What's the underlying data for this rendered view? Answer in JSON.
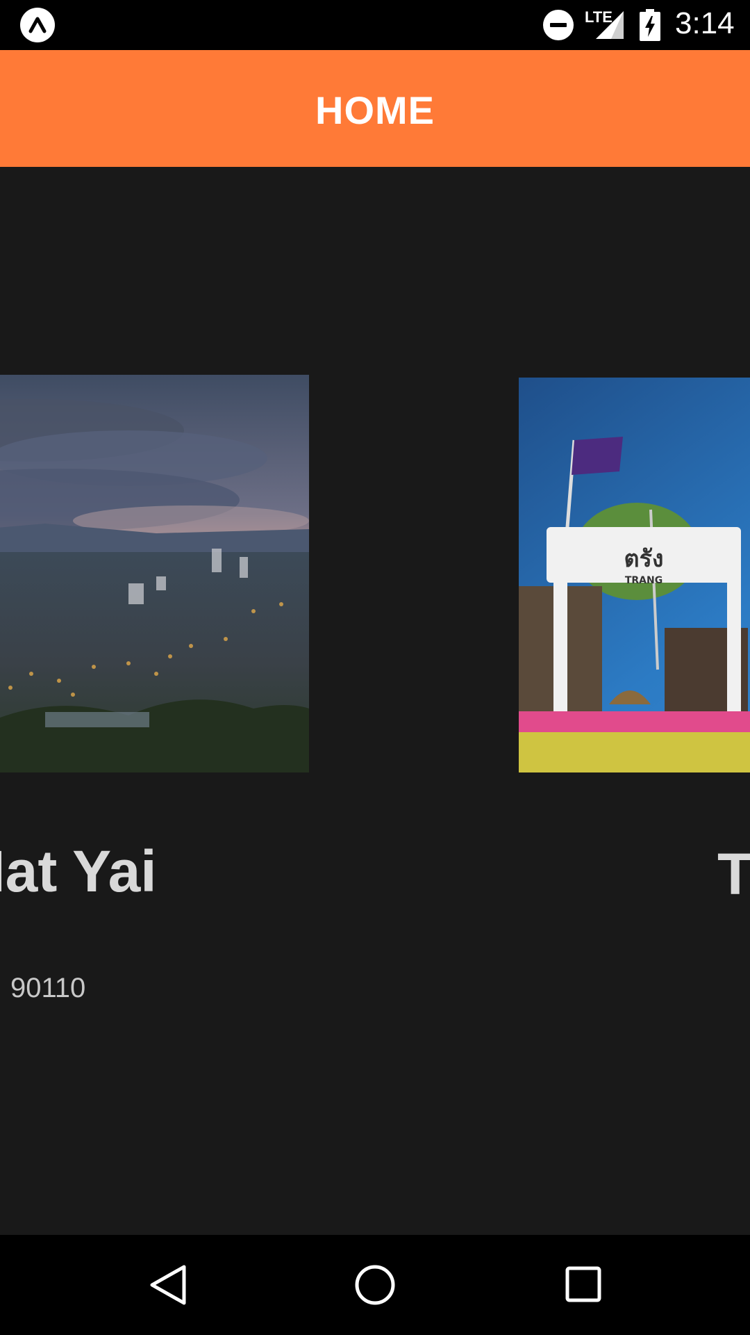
{
  "status_bar": {
    "time": "3:14",
    "network": "LTE",
    "icons": [
      "app-logo-icon",
      "do-not-disturb-icon",
      "signal-icon",
      "battery-charging-icon"
    ]
  },
  "app_bar": {
    "title": "HOME"
  },
  "cards": [
    {
      "title": "Hat Yai",
      "subtitle": "90110",
      "image_icon": "city-skyline-image"
    },
    {
      "title": "Trang",
      "subtitle": "",
      "image_icon": "trang-sign-image"
    }
  ],
  "nav_bar": {
    "icons": [
      "back-icon",
      "home-icon",
      "recents-icon"
    ]
  },
  "colors": {
    "app_bar": "#FF7A37",
    "background": "#191919",
    "title_text": "#D9D9D9"
  }
}
